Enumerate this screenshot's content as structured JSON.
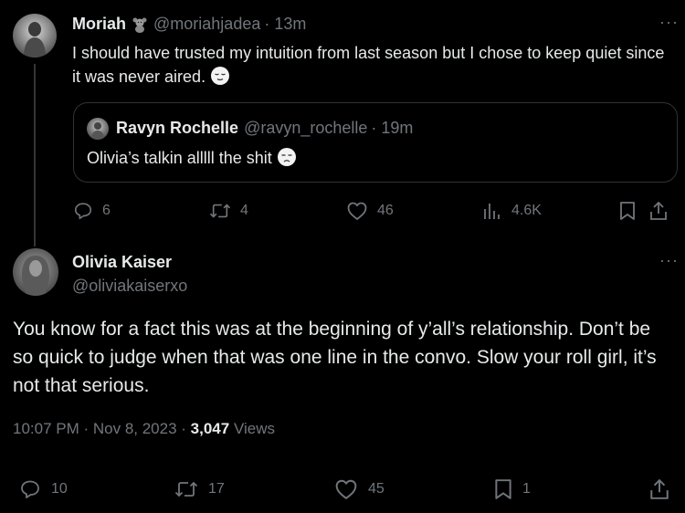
{
  "reply_tweet": {
    "author_name": "Moriah",
    "author_handle": "@moriahjadea",
    "time": "· 13m",
    "text": "I should have trusted my intuition from last season but I chose to keep quiet since it was never aired.",
    "quoted": {
      "author_name": "Ravyn Rochelle",
      "author_handle": "@ravyn_rochelle",
      "time": "· 19m",
      "text": "Olivia’s talkin alllll the shit"
    },
    "actions": {
      "replies": "6",
      "reposts": "4",
      "likes": "46",
      "views": "4.6K"
    }
  },
  "main_tweet": {
    "author_name": "Olivia Kaiser",
    "author_handle": "@oliviakaiserxo",
    "text": "You know for a fact this was at the beginning of y’all’s relationship. Don’t be so quick to judge when that was one line in the convo. Slow your roll girl, it’s not that serious.",
    "timestamp": "10:07 PM · Nov 8, 2023 ·",
    "views_count": "3,047",
    "views_label": "Views",
    "actions": {
      "replies": "10",
      "reposts": "17",
      "likes": "45",
      "bookmarks": "1"
    }
  },
  "icons": {
    "more": "more-icon",
    "reply": "reply-icon",
    "repost": "repost-icon",
    "like": "heart-icon",
    "views": "analytics-icon",
    "bookmark": "bookmark-icon",
    "share": "share-icon",
    "badge": "teddy-bear-icon"
  },
  "colors": {
    "background": "#000000",
    "text": "#e7e9ea",
    "muted": "#71767b",
    "border": "#2f3336"
  }
}
